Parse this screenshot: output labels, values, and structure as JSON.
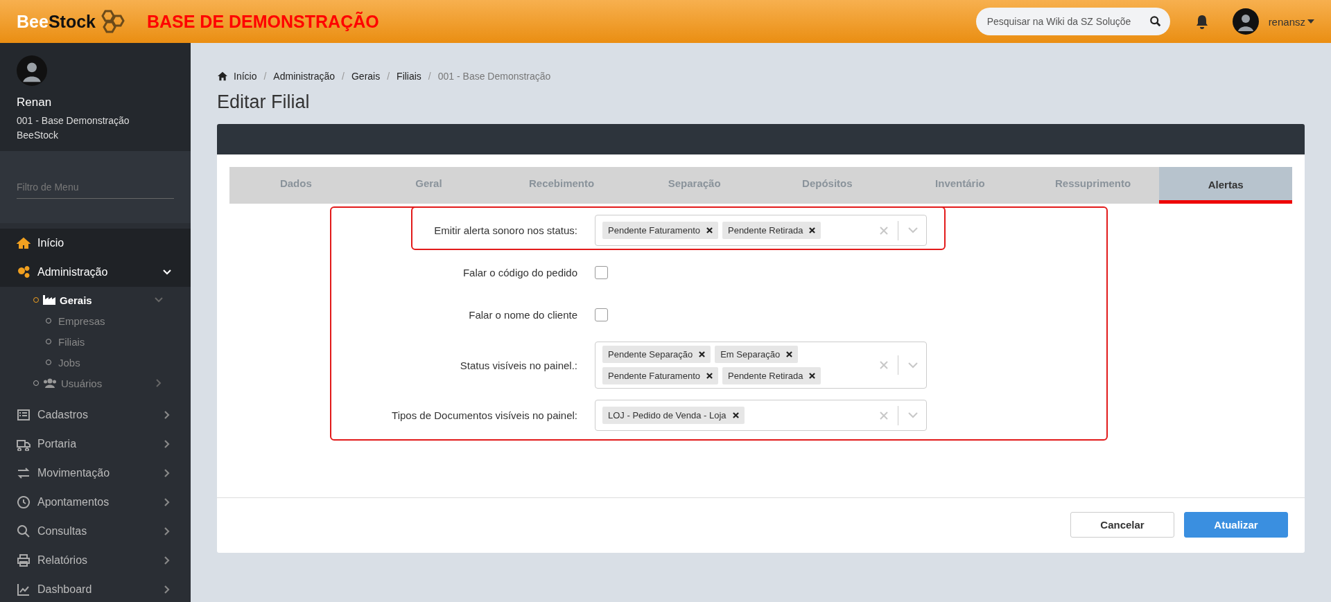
{
  "header": {
    "logo": {
      "part_1": "Bee",
      "part_2": "Stock"
    },
    "banner": "BASE DE DEMONSTRAÇÃO",
    "search": {
      "placeholder": "Pesquisar na Wiki da SZ Soluçõe"
    },
    "user": "renansz"
  },
  "sidebar": {
    "user": {
      "name": "Renan",
      "lines": [
        "001 - Base Demonstração",
        "BeeStock"
      ]
    },
    "filter": {
      "placeholder": "Filtro de Menu"
    },
    "items": [
      {
        "label": "Início",
        "kind": "link",
        "highlighted": true,
        "expanded": false
      },
      {
        "label": "Administração",
        "kind": "group",
        "highlighted": true,
        "expanded": true,
        "children": [
          {
            "label": "Gerais",
            "kind": "group",
            "selected": true,
            "expanded": true,
            "children": [
              {
                "label": "Empresas",
                "selected": false
              },
              {
                "label": "Filiais",
                "selected": false
              },
              {
                "label": "Jobs",
                "selected": false
              }
            ]
          },
          {
            "label": "Usuários",
            "kind": "group",
            "selected": false,
            "expanded": false
          }
        ]
      },
      {
        "label": "Cadastros",
        "kind": "group",
        "highlighted": false,
        "expanded": false
      },
      {
        "label": "Portaria",
        "kind": "group",
        "highlighted": false,
        "expanded": false
      },
      {
        "label": "Movimentação",
        "kind": "group",
        "highlighted": false,
        "expanded": false
      },
      {
        "label": "Apontamentos",
        "kind": "group",
        "highlighted": false,
        "expanded": false
      },
      {
        "label": "Consultas",
        "kind": "group",
        "highlighted": false,
        "expanded": false
      },
      {
        "label": "Relatórios",
        "kind": "group",
        "highlighted": false,
        "expanded": false
      },
      {
        "label": "Dashboard",
        "kind": "group",
        "highlighted": false,
        "expanded": false
      }
    ]
  },
  "breadcrumb": {
    "separator": "/",
    "items": [
      "Início",
      "Administração",
      "Gerais",
      "Filiais",
      "001 - Base Demonstração"
    ]
  },
  "page_title": "Editar Filial",
  "tabs": [
    {
      "label": "Dados",
      "selected": false
    },
    {
      "label": "Geral",
      "selected": false
    },
    {
      "label": "Recebimento",
      "selected": false
    },
    {
      "label": "Separação",
      "selected": false
    },
    {
      "label": "Depósitos",
      "selected": false
    },
    {
      "label": "Inventário",
      "selected": false
    },
    {
      "label": "Ressuprimento",
      "selected": false
    },
    {
      "label": "Alertas",
      "selected": true
    }
  ],
  "form": {
    "highlighted": true,
    "rows": [
      {
        "kind": "multiselect",
        "label": "Emitir alerta sonoro nos status:",
        "highlighted": true,
        "tags": [
          "Pendente Faturamento",
          "Pendente Retirada"
        ]
      },
      {
        "kind": "checkbox",
        "label": "Falar o código do pedido",
        "highlighted": false,
        "checked": false
      },
      {
        "kind": "checkbox",
        "label": "Falar o nome do cliente",
        "highlighted": false,
        "checked": false
      },
      {
        "kind": "multiselect",
        "label": "Status visíveis no painel.:",
        "highlighted": false,
        "tags": [
          "Pendente Separação",
          "Em Separação",
          "Pendente Faturamento",
          "Pendente Retirada"
        ]
      },
      {
        "kind": "multiselect",
        "label": "Tipos de Documentos visíveis no painel:",
        "highlighted": false,
        "tags": [
          "LOJ - Pedido de Venda - Loja"
        ]
      }
    ]
  },
  "buttons": [
    {
      "label": "Cancelar",
      "kind": "secondary"
    },
    {
      "label": "Atualizar",
      "kind": "primary"
    }
  ]
}
